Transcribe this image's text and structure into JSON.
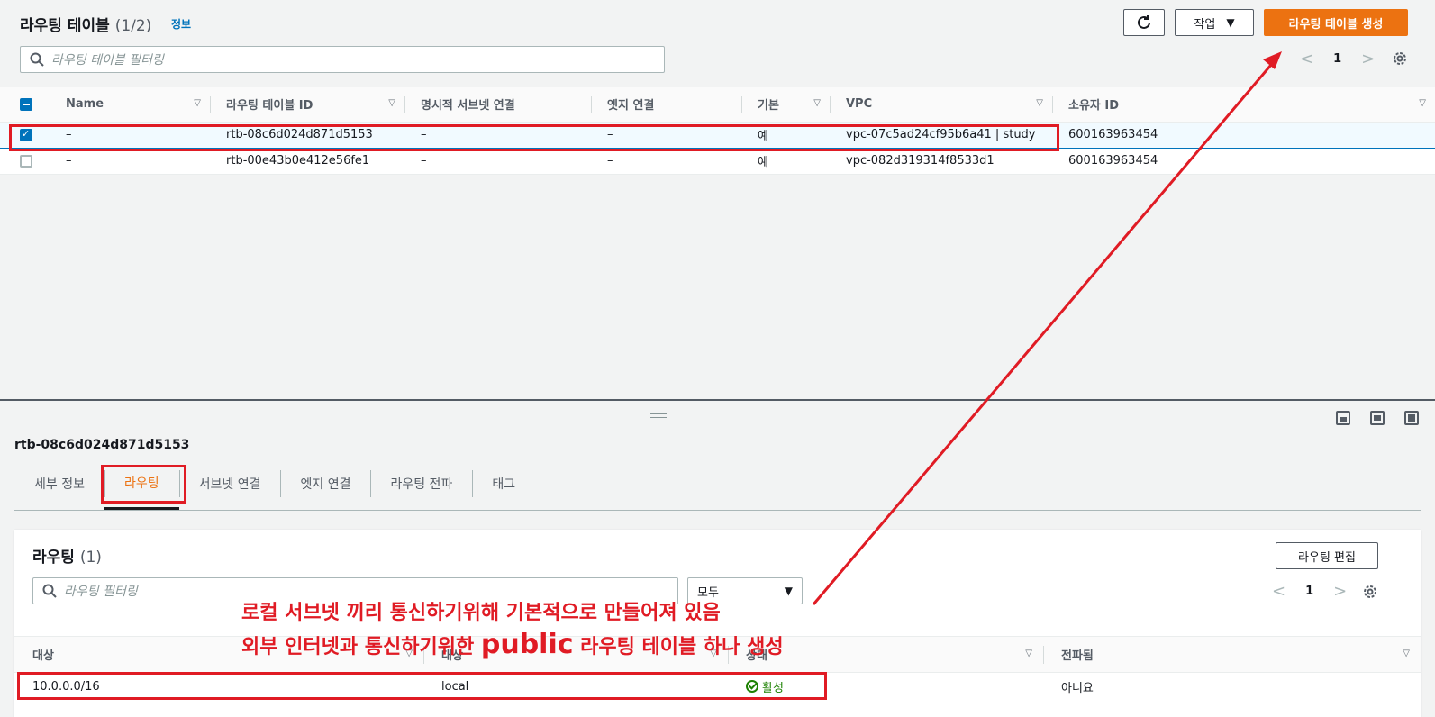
{
  "header": {
    "title": "라우팅 테이블",
    "count": "(1/2)",
    "info_link": "정보",
    "refresh_icon": "refresh-icon",
    "actions_label": "작업",
    "create_label": "라우팅 테이블 생성",
    "filter_placeholder": "라우팅 테이블 필터링",
    "page": "1"
  },
  "table": {
    "columns": [
      "Name",
      "라우팅 테이블 ID",
      "명시적 서브넷 연결",
      "엣지 연결",
      "기본",
      "VPC",
      "소유자 ID"
    ],
    "rows": [
      {
        "selected": true,
        "name": "–",
        "id": "rtb-08c6d024d871d5153",
        "subnet": "–",
        "edge": "–",
        "main": "예",
        "vpc": "vpc-07c5ad24cf95b6a41 | study",
        "owner": "600163963454"
      },
      {
        "selected": false,
        "name": "–",
        "id": "rtb-00e43b0e412e56fe1",
        "subnet": "–",
        "edge": "–",
        "main": "예",
        "vpc": "vpc-082d319314f8533d1",
        "owner": "600163963454"
      }
    ]
  },
  "detail": {
    "selected_id": "rtb-08c6d024d871d5153",
    "tabs": [
      "세부 정보",
      "라우팅",
      "서브넷 연결",
      "엣지 연결",
      "라우팅 전파",
      "태그"
    ],
    "active_tab": "라우팅"
  },
  "routes": {
    "title": "라우팅",
    "count": "(1)",
    "edit_label": "라우팅 편집",
    "filter_placeholder": "라우팅 필터링",
    "select_value": "모두",
    "page": "1",
    "columns": [
      "대상",
      "대상",
      "상태",
      "전파됨"
    ],
    "rows": [
      {
        "destination": "10.0.0.0/16",
        "target": "local",
        "status": "활성",
        "propagated": "아니요"
      }
    ]
  },
  "annotations": {
    "line1": "로컬 서브넷 끼리 통신하기위해 기본적으로 만들어져 있음",
    "line2_a": "외부 인터넷과 통신하기위한 ",
    "line2_b": "public",
    "line2_c": " 라우팅 테이블 하나 생성",
    "color": "#e01b24"
  }
}
